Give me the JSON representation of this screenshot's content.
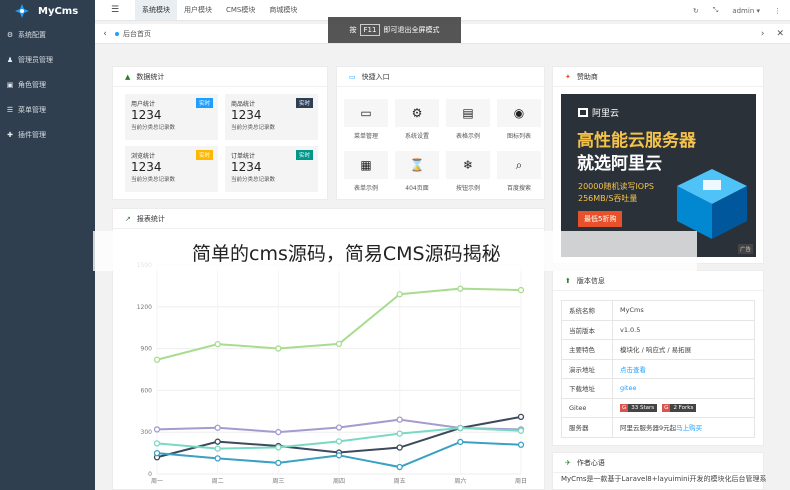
{
  "app": {
    "name": "MyCms"
  },
  "sidebar": {
    "items": [
      {
        "label": "系统配置",
        "icon": "gear-icon",
        "glyph": "⚙"
      },
      {
        "label": "管理员管理",
        "icon": "user-icon",
        "glyph": "♟"
      },
      {
        "label": "角色管理",
        "icon": "role-icon",
        "glyph": "▣"
      },
      {
        "label": "菜单管理",
        "icon": "menu-icon",
        "glyph": "☰"
      },
      {
        "label": "插件管理",
        "icon": "plugin-icon",
        "glyph": "✚"
      }
    ]
  },
  "topbar": {
    "tabs": [
      "系统模块",
      "用户模块",
      "CMS模块",
      "商城模块"
    ],
    "active_index": 0,
    "user": "admin ▾"
  },
  "tabbar": {
    "home_label": "后台首页"
  },
  "toast": {
    "prefix": "按",
    "key": "F11",
    "suffix": "即可退出全屏模式"
  },
  "stats_card": {
    "title": "数据统计",
    "items": [
      {
        "label": "用户统计",
        "value": "1234",
        "sub": "当前分类总记录数",
        "badge": "实时",
        "badge_color": "#1e9fff"
      },
      {
        "label": "商品统计",
        "value": "1234",
        "sub": "当前分类总记录数",
        "badge": "实时",
        "badge_color": "#2f4056"
      },
      {
        "label": "浏览统计",
        "value": "1234",
        "sub": "当前分类总记录数",
        "badge": "实时",
        "badge_color": "#ffb800"
      },
      {
        "label": "订单统计",
        "value": "1234",
        "sub": "当前分类总记录数",
        "badge": "实时",
        "badge_color": "#009688"
      }
    ]
  },
  "quick_card": {
    "title": "快捷入口",
    "items": [
      {
        "label": "菜单管理",
        "icon": "window-icon",
        "glyph": "▭"
      },
      {
        "label": "系统设置",
        "icon": "gears-icon",
        "glyph": "⚙"
      },
      {
        "label": "表格示例",
        "icon": "document-icon",
        "glyph": "▤"
      },
      {
        "label": "图标列表",
        "icon": "dot-circle-icon",
        "glyph": "◉"
      },
      {
        "label": "表单示例",
        "icon": "calendar-icon",
        "glyph": "▦"
      },
      {
        "label": "404页面",
        "icon": "hourglass-icon",
        "glyph": "⌛"
      },
      {
        "label": "按钮示例",
        "icon": "snowflake-icon",
        "glyph": "❄"
      },
      {
        "label": "百度搜索",
        "icon": "search-icon",
        "glyph": "⌕"
      }
    ]
  },
  "sponsor_card": {
    "title": "赞助商",
    "ad": {
      "brand": "阿里云",
      "headline1": "高性能云服务器",
      "headline2": "就选阿里云",
      "line1": "20000随机读写IOPS",
      "line2": "256MB/S吞吐量",
      "button": "最低5折购",
      "tag": "广告"
    }
  },
  "report_card": {
    "title": "报表统计"
  },
  "version_card": {
    "title": "版本信息",
    "rows": [
      {
        "key": "系统名称",
        "value": "MyCms"
      },
      {
        "key": "当前版本",
        "value": "v1.0.5"
      },
      {
        "key": "主要特色",
        "value": "模块化 / 响应式 / 易拓展"
      },
      {
        "key": "演示地址",
        "value": "点击查看",
        "link": true
      },
      {
        "key": "下载地址",
        "value": "gitee",
        "link": true
      },
      {
        "key": "Gitee",
        "stars": "33 Stars",
        "forks": "2 Forks"
      },
      {
        "key": "服务器",
        "value": "阿里云服务器9元起",
        "link_tail": "马上购买"
      }
    ]
  },
  "author_card": {
    "title": "作者心语",
    "text": "MyCms是一款基于Laravel8+layuimini开发的模块化后台管理系"
  },
  "watermark": {
    "text": "简单的cms源码，简易CMS源码揭秘"
  },
  "chart_data": {
    "type": "line",
    "categories": [
      "周一",
      "周二",
      "周三",
      "周四",
      "周五",
      "周六",
      "周日"
    ],
    "ylim": [
      0,
      1500
    ],
    "yticks": [
      0,
      300,
      600,
      900,
      1200,
      1500
    ],
    "series": [
      {
        "color": "#a8dc8f",
        "values": [
          820,
          932,
          901,
          934,
          1290,
          1330,
          1320
        ]
      },
      {
        "color": "#a59bcf",
        "values": [
          320,
          332,
          301,
          334,
          390,
          330,
          320
        ]
      },
      {
        "color": "#3d4a5d",
        "values": [
          120,
          232,
          201,
          154,
          190,
          330,
          410
        ]
      },
      {
        "color": "#7ad9c2",
        "values": [
          220,
          182,
          191,
          234,
          290,
          330,
          310
        ]
      },
      {
        "color": "#3aa0c4",
        "values": [
          150,
          112,
          80,
          134,
          50,
          230,
          210
        ]
      }
    ]
  }
}
